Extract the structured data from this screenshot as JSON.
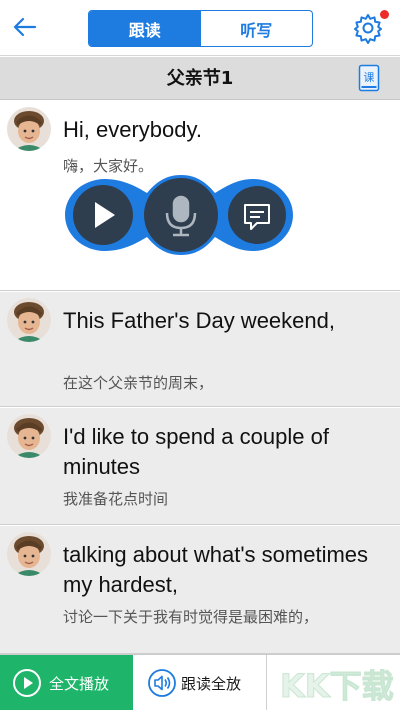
{
  "header": {
    "tabs": [
      {
        "label": "跟读",
        "active": true
      },
      {
        "label": "听写",
        "active": false
      }
    ],
    "has_notification_dot": true
  },
  "lesson": {
    "title": "父亲节1",
    "course_icon_label": "课"
  },
  "sentences": [
    {
      "en": "Hi, everybody.",
      "zh": "嗨，大家好。",
      "selected": true
    },
    {
      "en": "This Father's Day weekend,",
      "zh": "在这个父亲节的周末，",
      "selected": false
    },
    {
      "en": "I'd like to spend a couple of minutes",
      "zh": "我准备花点时间",
      "selected": false
    },
    {
      "en": "talking about what's sometimes my hardest,",
      "zh": "讨论一下关于我有时觉得是最困难的，",
      "selected": false
    }
  ],
  "controls": {
    "icons": [
      "play-icon",
      "microphone-icon",
      "comment-icon"
    ]
  },
  "footer": {
    "play_all_label": "全文播放",
    "follow_all_label": "跟读全放"
  },
  "watermark": {
    "text": "KK下载"
  },
  "colors": {
    "accent": "#1e7be0",
    "green": "#1eb56a",
    "alert_dot": "#ee2b2b",
    "control_dark": "#2f3e4e"
  }
}
